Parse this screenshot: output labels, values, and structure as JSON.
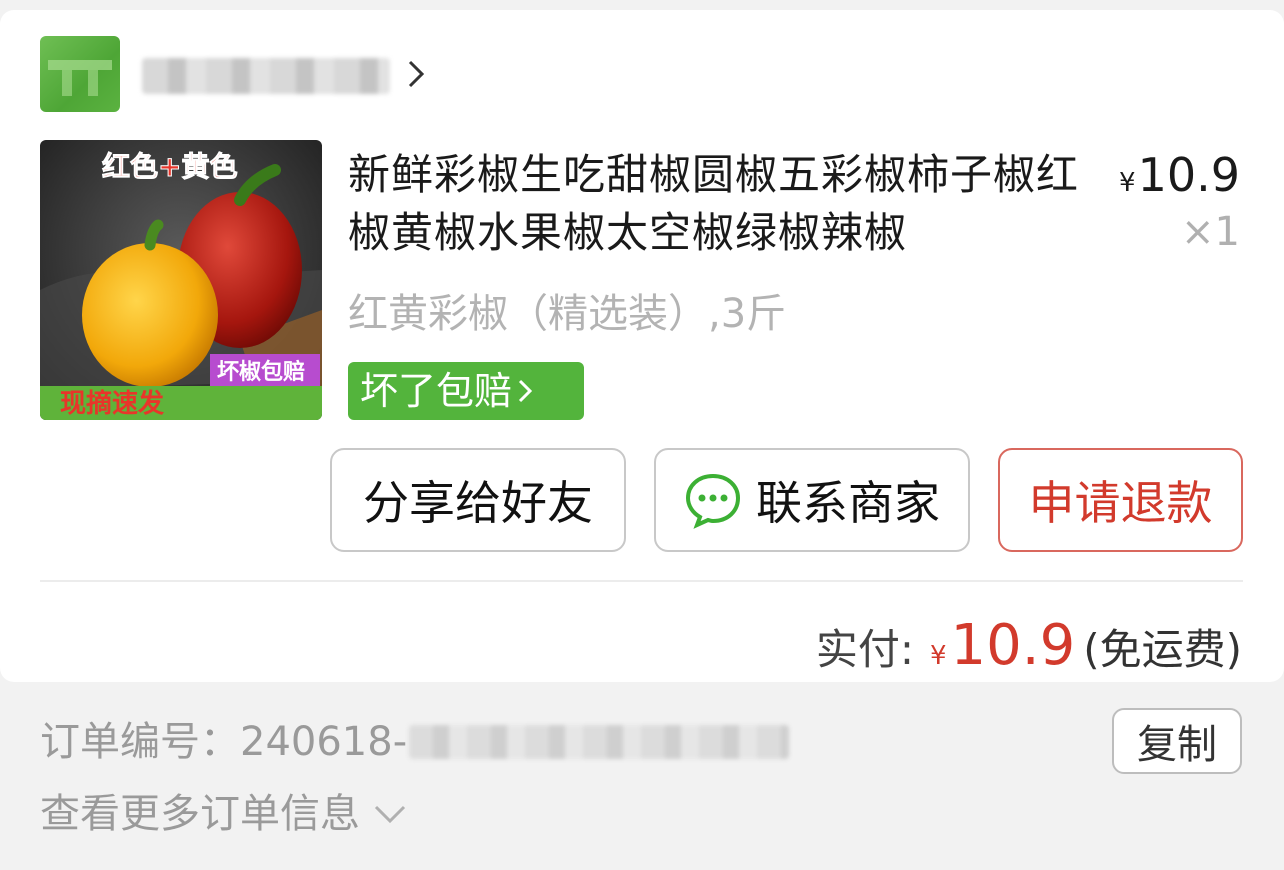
{
  "shop": {
    "name_redacted": true
  },
  "product": {
    "image_text_top": "红色+黄色",
    "image_badge": "坏椒包赔",
    "image_bottom": "现摘速发",
    "title": "新鲜彩椒生吃甜椒圆椒五彩椒柿子椒红椒黄椒水果椒太空椒绿椒辣椒",
    "price_symbol": "¥",
    "price": "10.9",
    "quantity": "×1",
    "spec": "红黄彩椒（精选装）,3斤",
    "guarantee": "坏了包赔"
  },
  "actions": {
    "share": "分享给好友",
    "contact": "联系商家",
    "refund": "申请退款"
  },
  "payment": {
    "label": "实付:",
    "symbol": "¥",
    "amount": "10.9",
    "shipping": "(免运费)"
  },
  "order": {
    "number_label": "订单编号：",
    "number_prefix": "240618-",
    "copy": "复制",
    "more": "查看更多订单信息"
  },
  "colors": {
    "accent_red": "#d23a2c",
    "guarantee_green": "#53b43c",
    "wechat_green": "#3cb034"
  }
}
